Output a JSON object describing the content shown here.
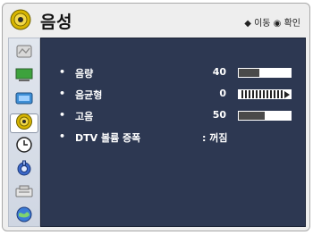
{
  "header": {
    "title": "음성",
    "nav_hint": "◆ 이동 ◉ 확인"
  },
  "sidebar": {
    "items": [
      {
        "icon": "picture-icon",
        "active": false
      },
      {
        "icon": "screen-icon",
        "active": false
      },
      {
        "icon": "channel-icon",
        "active": false
      },
      {
        "icon": "audio-icon",
        "active": true
      },
      {
        "icon": "clock-icon",
        "active": false
      },
      {
        "icon": "lock-icon",
        "active": false
      },
      {
        "icon": "option-icon",
        "active": false
      },
      {
        "icon": "network-icon",
        "active": false
      }
    ]
  },
  "settings": [
    {
      "label": "음량",
      "value": "40",
      "level": 0.4
    },
    {
      "label": "음균형",
      "value": "0"
    },
    {
      "label": "고음",
      "value": "50",
      "level": 0.5
    },
    {
      "label": "DTV 볼륨 증폭",
      "value": ": 꺼짐"
    }
  ],
  "colors": {
    "panel_bg": "#2d3852",
    "bar_fill": "#4a4a4a",
    "text": "#ffffff"
  }
}
